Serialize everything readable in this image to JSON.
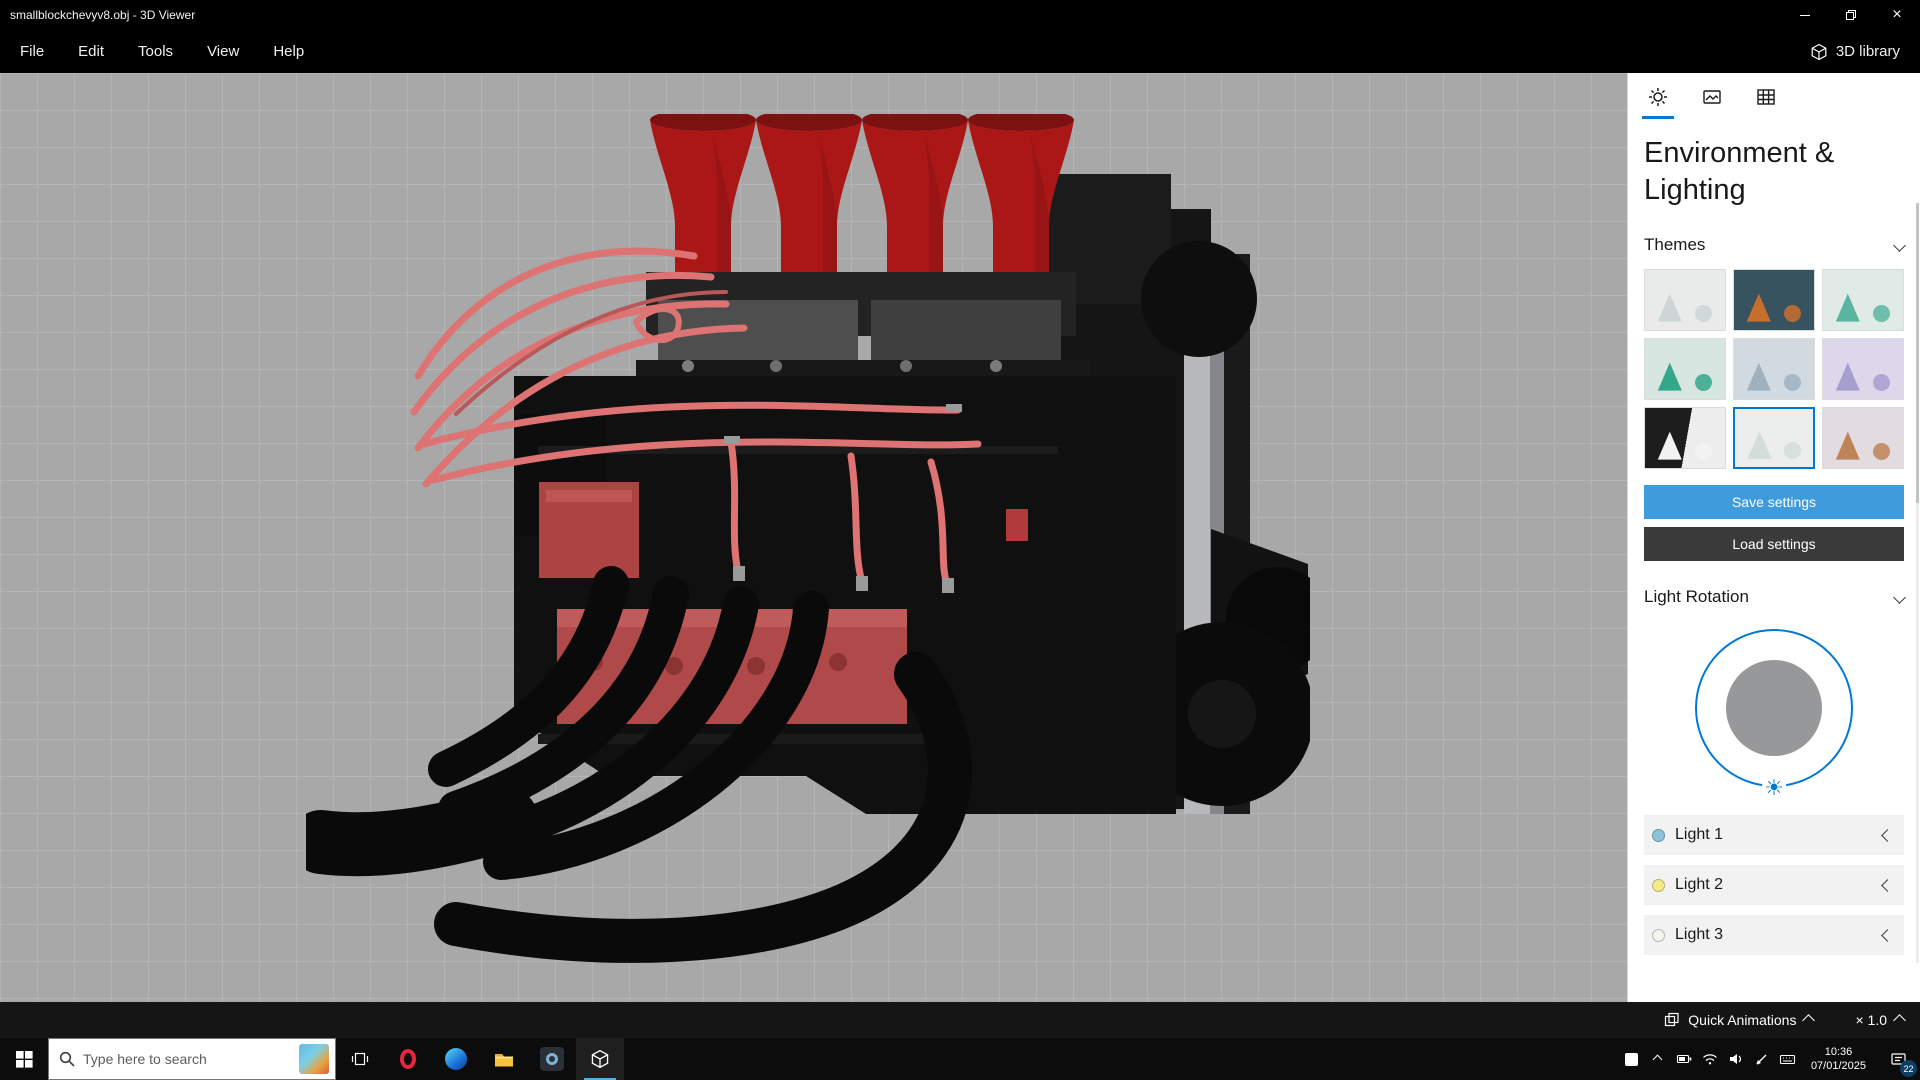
{
  "colors": {
    "accent": "#0078d4",
    "save_button": "#3f9bdb",
    "load_button": "#3a3a3a",
    "viewport_bg": "#a8a8a8",
    "grid_line": "#b5b5b5"
  },
  "window": {
    "title": "smallblockchevyv8.obj - 3D Viewer",
    "close_glyph": "×"
  },
  "menu": {
    "items": [
      "File",
      "Edit",
      "Tools",
      "View",
      "Help"
    ],
    "library": "3D library"
  },
  "panel": {
    "heading": "Environment & Lighting",
    "themes_label": "Themes",
    "light_rotation_label": "Light Rotation",
    "save_label": "Save settings",
    "load_label": "Load settings",
    "sun_glyph": "☀",
    "themes": [
      {
        "name": "theme-1",
        "bg": "#e9ebeb",
        "accent": "#cdd5d5"
      },
      {
        "name": "theme-2",
        "bg": "#37535f",
        "accent": "#c96f2e"
      },
      {
        "name": "theme-3",
        "bg": "#e0eae7",
        "accent": "#5ab5a0"
      },
      {
        "name": "theme-4",
        "bg": "#d7e6e0",
        "accent": "#35a78c"
      },
      {
        "name": "theme-5",
        "bg": "#d2dae1",
        "accent": "#9fb1bf"
      },
      {
        "name": "theme-6",
        "bg": "#dcd7ea",
        "accent": "#a79ed0"
      },
      {
        "name": "theme-7",
        "bg": "linear-gradient(100deg,#1d1d1d 52%,#ededed 52%)",
        "accent": "#f2f2f2"
      },
      {
        "name": "theme-8",
        "bg": "#eceeee",
        "accent": "#d5dcdc",
        "selected": true
      },
      {
        "name": "theme-9",
        "bg": "#e2dbdf",
        "accent": "#bd8457"
      }
    ],
    "lights": [
      {
        "label": "Light 1",
        "color": "#8cc3d9"
      },
      {
        "label": "Light 2",
        "color": "#f7e98c"
      },
      {
        "label": "Light 3",
        "color": "#f4f4ec"
      }
    ]
  },
  "bottom_bar": {
    "quick_animations": "Quick Animations",
    "scale": "× 1.0"
  },
  "taskbar": {
    "search_placeholder": "Type here to search",
    "time": "10:36",
    "date": "07/01/2025",
    "badge": "22"
  }
}
